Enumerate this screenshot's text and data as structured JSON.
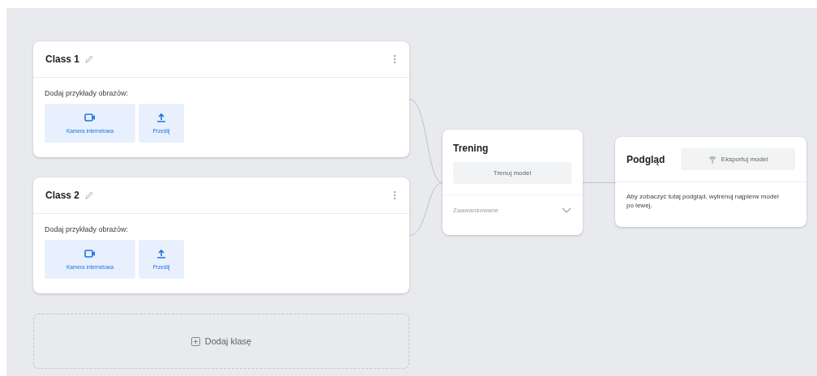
{
  "classes": [
    {
      "name": "Class 1",
      "prompt": "Dodaj przykłady obrazów:",
      "sources": [
        {
          "label": "Kamera internetowa",
          "kind": "webcam"
        },
        {
          "label": "Prześlij",
          "kind": "upload"
        }
      ]
    },
    {
      "name": "Class 2",
      "prompt": "Dodaj przykłady obrazów:",
      "sources": [
        {
          "label": "Kamera internetowa",
          "kind": "webcam"
        },
        {
          "label": "Prześlij",
          "kind": "upload"
        }
      ]
    }
  ],
  "add_class": {
    "label": "Dodaj klasę"
  },
  "training": {
    "title": "Trening",
    "button": "Trenuj model",
    "advanced": "Zaawansowane"
  },
  "preview": {
    "title": "Podgląd",
    "export_button": "Eksportuj model",
    "message": "Aby zobaczyć tutaj podgląd, wytrenuj najpierw model po lewej."
  }
}
